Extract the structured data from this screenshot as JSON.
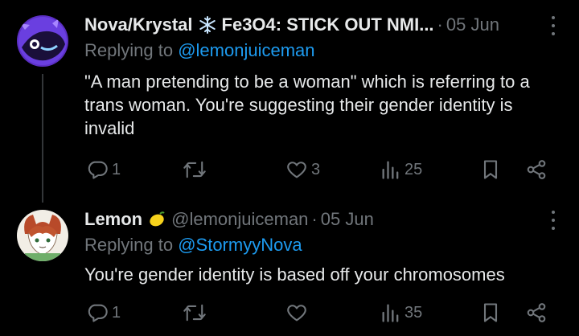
{
  "tweets": [
    {
      "name": "Nova/Krystal",
      "name_suffix": "Fe3O4: STICK OUT NMI...",
      "name_emoji": "snowflake-icon",
      "handle": "",
      "dot": "·",
      "date": "05 Jun",
      "replying_prefix": "Replying to",
      "replying_mention": "@lemonjuiceman",
      "text": "\"A man pretending to be a woman\" which is referring to a trans woman. You're suggesting their gender identity is invalid",
      "replies": "1",
      "retweets": "",
      "likes": "3",
      "views": "25"
    },
    {
      "name": "Lemon",
      "name_suffix": "",
      "name_emoji": "lemon-icon",
      "handle": "@lemonjuiceman",
      "dot": "·",
      "date": "05 Jun",
      "replying_prefix": "Replying to",
      "replying_mention": "@StormyyNova",
      "text": "You're gender identity is based off your chromosomes",
      "replies": "1",
      "retweets": "",
      "likes": "",
      "views": "35"
    }
  ],
  "colors": {
    "background": "#000000",
    "text": "#e7e9ea",
    "muted": "#71767b",
    "accent": "#1d9bf0"
  }
}
